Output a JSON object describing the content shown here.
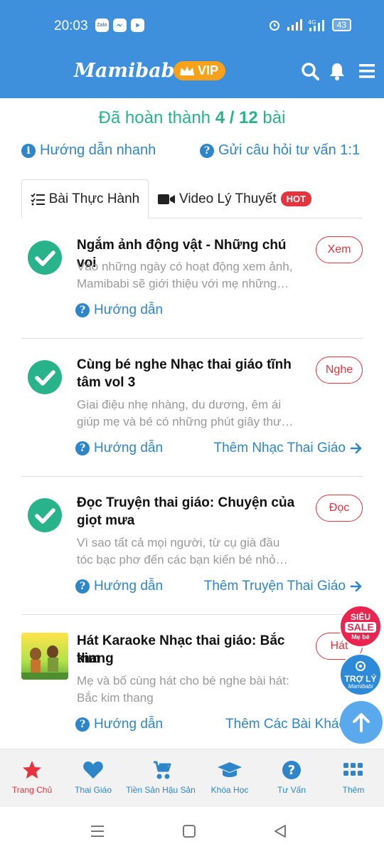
{
  "status_bar": {
    "time": "20:03",
    "app_icons": [
      "zalo-icon",
      "messenger-icon",
      "youtube-icon"
    ],
    "battery": "43"
  },
  "header": {
    "logo": "Mamibabi",
    "vip_badge": "VIP"
  },
  "progress": {
    "prefix": "Đã hoàn thành",
    "value": "4 / 12",
    "suffix": "bài"
  },
  "quick_links": {
    "guide": "Hướng dẫn nhanh",
    "consult": "Gửi câu hỏi tư vấn 1:1"
  },
  "tabs": [
    {
      "label": "Bài Thực Hành",
      "icon": "checklist-icon",
      "active": true
    },
    {
      "label": "Video Lý Thuyết",
      "icon": "video-icon",
      "badge": "HOT"
    }
  ],
  "lessons": [
    {
      "title": "Ngắm ảnh động vật - Những chú voi",
      "desc_line1": "Vào những ngày có hoạt động xem ảnh,",
      "desc_line2": "Mamibabi sẽ giới thiệu với mẹ những…",
      "action": "Xem",
      "guide": "Hướng dẫn",
      "more": "",
      "completed": true
    },
    {
      "title_line1": "Cùng bé nghe Nhạc thai giáo tĩnh",
      "title_line2": "tâm vol 3",
      "desc_line1": "Giai điệu nhẹ nhàng, du dương, êm ái",
      "desc_line2": "giúp mẹ và bé có những phút giây thư…",
      "action": "Nghe",
      "guide": "Hướng dẫn",
      "more": "Thêm Nhạc Thai Giáo",
      "completed": true
    },
    {
      "title_line1": "Đọc Truyện thai giáo: Chuyện của",
      "title_line2": "giọt mưa",
      "desc_line1": "Vì sao tất cả mọi người, từ cụ già đầu",
      "desc_line2": "tóc bạc phơ đến các bạn kiến bé nhỏ…",
      "action": "Đọc",
      "guide": "Hướng dẫn",
      "more": "Thêm Truyện Thai Giáo",
      "completed": true
    },
    {
      "title_line1": "Hát Karaoke Nhạc thai giáo: Bắc kim",
      "title_line2": "thang",
      "desc_line1": "Mẹ và bố cùng hát cho bé nghe bài hát:",
      "desc_line2": "Bắc kim thang",
      "action": "Hát",
      "guide": "Hướng dẫn",
      "more": "Thêm Các Bài Khác",
      "completed": false
    }
  ],
  "floating": {
    "sale_line1": "SIÊU",
    "sale_line2": "SALE",
    "sale_line3": "Mẹ bé",
    "assistant_line1": "TRỢ LÝ",
    "assistant_line2": "Mamibabi"
  },
  "bottom_nav": [
    {
      "label": "Trang Chủ",
      "icon": "star-icon",
      "active": true
    },
    {
      "label": "Thai Giáo",
      "icon": "heart-icon"
    },
    {
      "label": "Tiền Sản Hậu Sản",
      "icon": "stroller-icon"
    },
    {
      "label": "Khóa Học",
      "icon": "graduation-cap-icon"
    },
    {
      "label": "Tư Vấn",
      "icon": "question-icon"
    },
    {
      "label": "Thêm",
      "icon": "grid-icon"
    }
  ],
  "colors": {
    "primary": "#3e8fdc",
    "accent_green": "#28b38a",
    "link_blue": "#2e86c9",
    "red": "#e5343d",
    "vip_orange": "#f7a11a"
  }
}
